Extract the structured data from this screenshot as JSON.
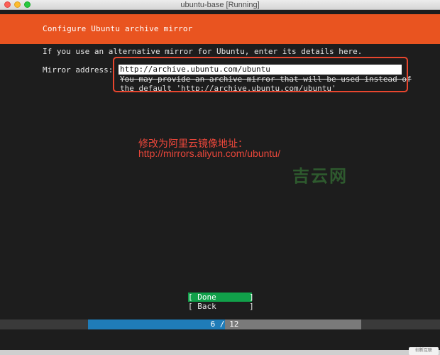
{
  "window": {
    "title": "ubuntu-base [Running]"
  },
  "installer": {
    "header": "Configure Ubuntu archive mirror",
    "intro": "If you use an alternative mirror for Ubuntu, enter its details here.",
    "mirror_label": "Mirror address:",
    "mirror_value": "http://archive.ubuntu.com/ubuntu",
    "hint_line1": "You may provide an archive mirror that will be used instead of",
    "hint_line2": "the default 'http://archive.ubuntu.com/ubuntu'",
    "done_label": "[ Done       ]",
    "back_label": "[ Back       ]",
    "progress_text": "6 / 12",
    "progress_fraction": 0.5
  },
  "annotation": {
    "line1": "修改为阿里云镜像地址：",
    "line2": "http://mirrors.aliyun.com/ubuntu/",
    "color": "#e8463a"
  },
  "watermark": {
    "text": "吉云网"
  },
  "logo": {
    "text": "创新互联"
  },
  "colors": {
    "ubuntu_orange": "#e95420",
    "done_green": "#11a04a",
    "progress_blue": "#1f7cb8"
  }
}
